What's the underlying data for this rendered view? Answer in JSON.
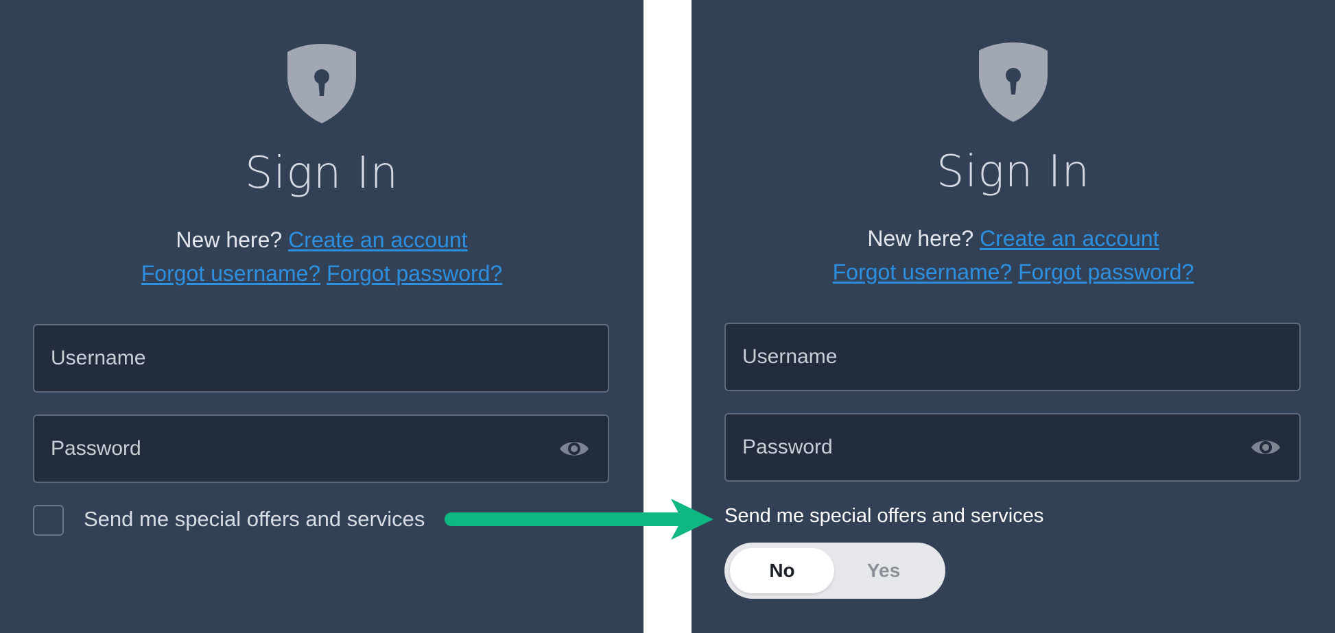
{
  "left": {
    "title": "Sign In",
    "new_here": "New here?",
    "create_account": "Create an account",
    "forgot_username": "Forgot username?",
    "forgot_password": "Forgot password?",
    "username_placeholder": "Username",
    "password_placeholder": "Password",
    "offers_label": "Send me special offers and services"
  },
  "right": {
    "title": "Sign In",
    "new_here": "New here?",
    "create_account": "Create an account",
    "forgot_username": "Forgot username?",
    "forgot_password": "Forgot password?",
    "username_placeholder": "Username",
    "password_placeholder": "Password",
    "offers_label": "Send me special offers and services",
    "toggle": {
      "no": "No",
      "yes": "Yes",
      "selected": "No"
    }
  },
  "colors": {
    "panel_bg": "#334157",
    "link": "#2d8fe0",
    "arrow": "#0fb882",
    "input_bg": "#222c3c"
  },
  "icons": [
    "shield-keyhole-icon",
    "eye-icon",
    "arrow-right-icon"
  ]
}
